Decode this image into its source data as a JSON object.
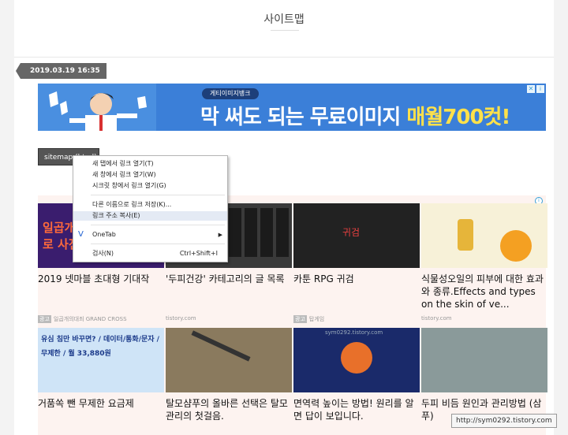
{
  "page": {
    "title": "사이트맵",
    "date": "2019.03.19 16:35"
  },
  "banner": {
    "pill": "게티이미지뱅크",
    "text_main": "막 써도 되는 무료이미지 ",
    "text_highlight": "매월700컷!",
    "ad_info": "i",
    "ad_close": "✕"
  },
  "sitemap_button": {
    "label": "sitemap (html)"
  },
  "context_menu": {
    "items": [
      {
        "label": "새 탭에서 링크 열기(T)",
        "shortcut": ""
      },
      {
        "label": "새 창에서 링크 열기(W)",
        "shortcut": ""
      },
      {
        "label": "시크릿 창에서 링크 열기(G)",
        "shortcut": ""
      },
      {
        "label": "다른 이름으로 링크 저장(K)...",
        "shortcut": ""
      },
      {
        "label": "링크 주소 복사(E)",
        "shortcut": ""
      },
      {
        "label": "OneTab",
        "shortcut": ""
      },
      {
        "label": "검사(N)",
        "shortcut": "Ctrl+Shift+I"
      }
    ],
    "submenu_arrow": "▶",
    "onetab_icon": "V"
  },
  "ads": {
    "info_icon": "i",
    "cards": [
      {
        "title": "2019 넷마블 초대형 기대작",
        "source": "일곱개의대죄 GRAND CROSS",
        "badge": "광고",
        "image_text": "일곱개의대죄 / 지금 바로 사전예약",
        "color": "#3a1d6e"
      },
      {
        "title": "'두피건강' 카테고리의 글 목록",
        "source": "tistory.com",
        "badge": "",
        "image_text": "",
        "color": "#3a3a3a"
      },
      {
        "title": "카툰 RPG 귀검",
        "source": "탑게임",
        "badge": "광고",
        "image_text": "귀검",
        "color": "#222222"
      },
      {
        "title": "식물성오일의 피부에 대한 효과와 종류.Effects and types on the skin of ve...",
        "source": "tistory.com",
        "badge": "",
        "image_text": "",
        "color": "#f2c24a"
      },
      {
        "title": "거품쏙 뺀 무제한 요금제",
        "source": "",
        "badge": "",
        "image_text": "유심 침만 바꾸면? / 데이터/통화/문자 / 무제한 / 월 33,880원",
        "color": "#cfe4f7"
      },
      {
        "title": "탈모샴푸의 올바른 선택은 탈모관리의 첫걸음.",
        "source": "",
        "badge": "",
        "image_text": "",
        "color": "#8a7a5e"
      },
      {
        "title": "면역력 높이는 방법! 원리를 알면 답이 보입니다.",
        "source": "",
        "badge": "",
        "image_text": "sym0292.tistory.com",
        "color": "#1a2a6a"
      },
      {
        "title": "두피 비듬 원인과 관리방법 (삼푸)",
        "source": "",
        "badge": "",
        "image_text": "",
        "color": "#7a8a8a"
      }
    ]
  },
  "status_url": "http://sym0292.tistory.com"
}
